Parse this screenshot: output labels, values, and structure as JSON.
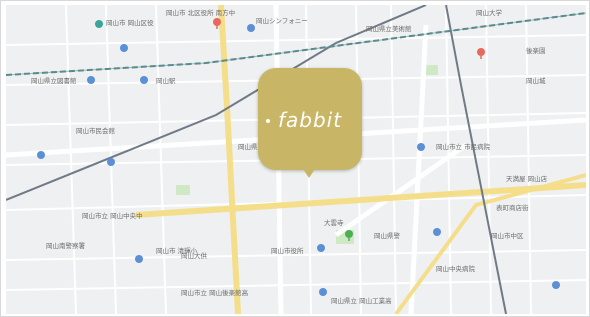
{
  "map": {
    "colors": {
      "background": "#eef0f1",
      "major_road": "#f5de8a",
      "road": "#ffffff",
      "rail": "#6f7a86",
      "park": "#cfe9c6",
      "poi_blue": "#5b8fd6",
      "poi_red": "#e9675c",
      "poi_green": "#4caf50"
    },
    "labels": [
      "岡山市 岡山区役",
      "岡山市 北区役所 南方中",
      "岡山県立図書館",
      "岡山大学",
      "岡山駅",
      "岡山市民会館",
      "岡山県庁",
      "岡山城",
      "後楽園",
      "岡山市立 市民病院",
      "岡山県立美術館",
      "岡山シンフォニー",
      "天満屋 岡山店",
      "表町商店街",
      "岡山市中区",
      "岡山南警察署",
      "岡山市立 岡山中央中",
      "岡山大供",
      "岡山市役所",
      "岡山県警",
      "大雲寺",
      "岡山市 清輝小",
      "岡山県立 岡山工業高",
      "岡山市立 岡山後楽館高",
      "岡山中央病院"
    ]
  },
  "marker": {
    "brand": "fabbit",
    "color": "#c8b566",
    "text_color": "#ffffff"
  },
  "map_icons": [
    "poi-pin-icon",
    "hospital-pin-icon",
    "park-pin-icon"
  ]
}
